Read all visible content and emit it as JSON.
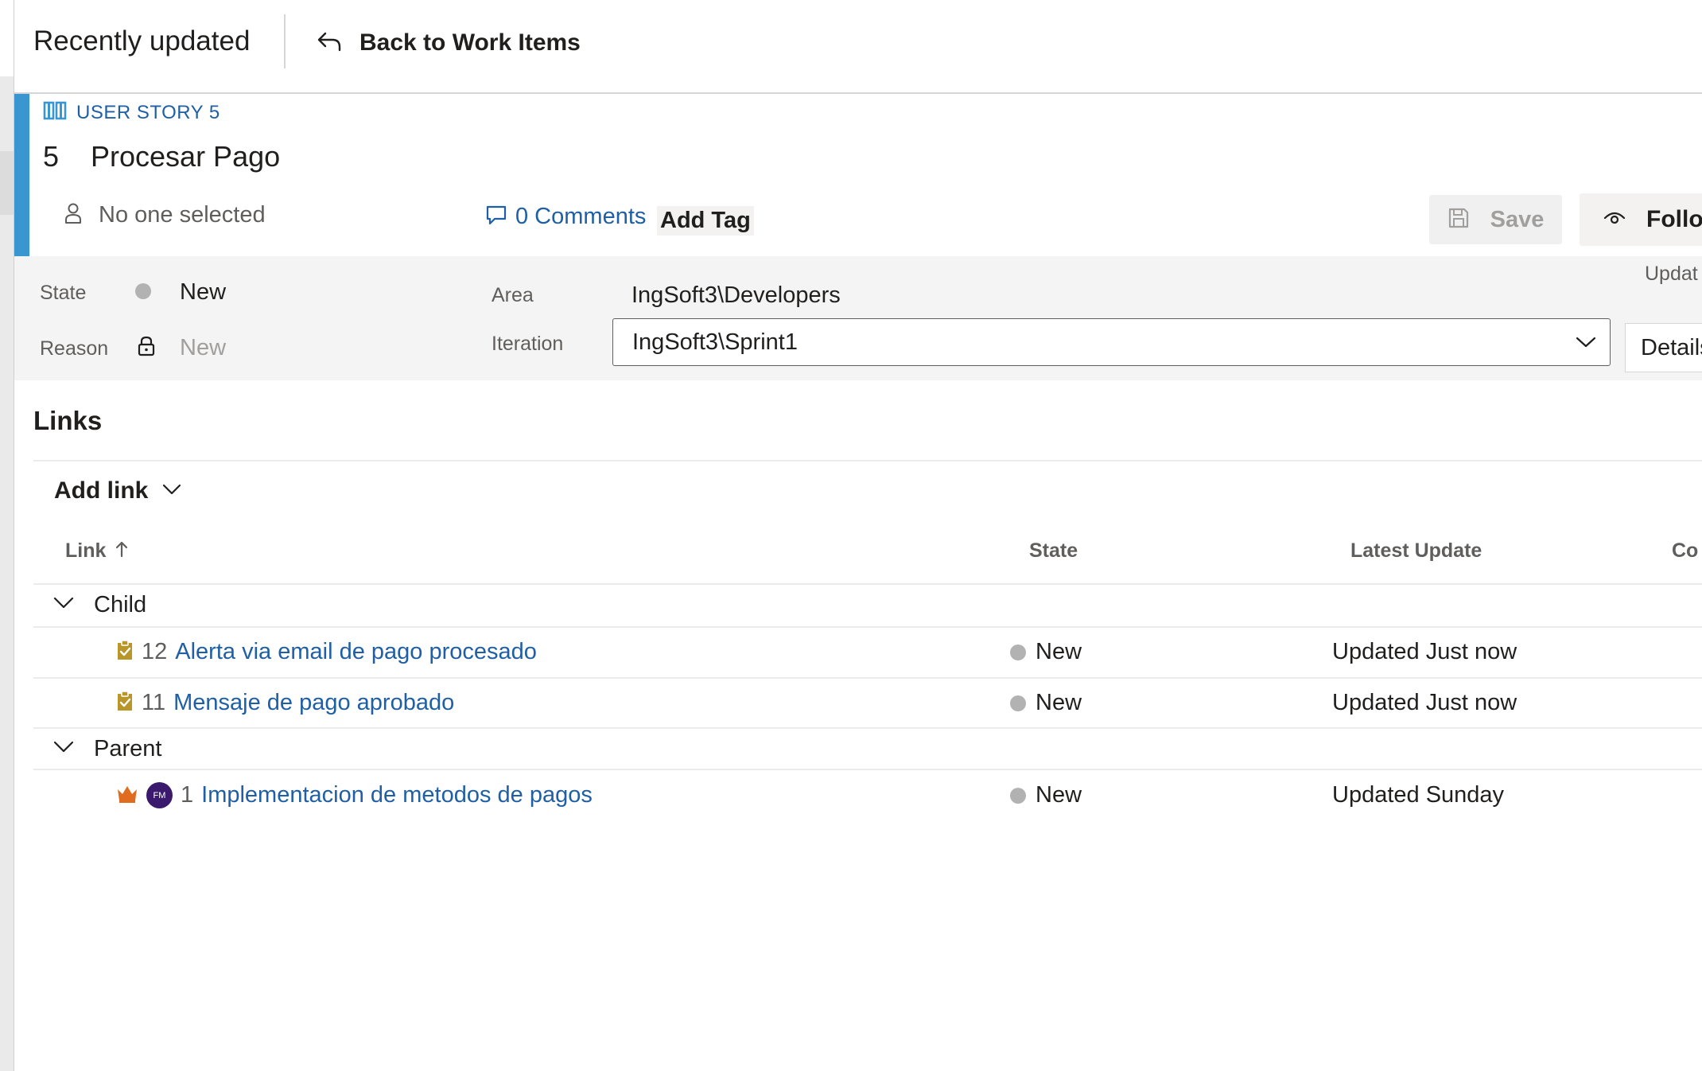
{
  "header": {
    "title": "Recently updated",
    "back_label": "Back to Work Items"
  },
  "work_item": {
    "type_label": "USER STORY 5",
    "id": "5",
    "title": "Procesar Pago",
    "assignee": "No one selected",
    "comments_label": "0 Comments",
    "add_tag_label": "Add Tag",
    "save_label": "Save",
    "follow_label": "Follow",
    "accent_color": "#3a96d1"
  },
  "fields": {
    "state_label": "State",
    "state_value": "New",
    "reason_label": "Reason",
    "reason_value": "New",
    "area_label": "Area",
    "area_value": "IngSoft3\\Developers",
    "iteration_label": "Iteration",
    "iteration_value": "IngSoft3\\Sprint1",
    "updated_label": "Updat",
    "details_tab": "Details"
  },
  "links": {
    "title": "Links",
    "add_link_label": "Add link",
    "columns": {
      "link": "Link",
      "state": "State",
      "latest_update": "Latest Update",
      "comment": "Co"
    },
    "groups": [
      {
        "name": "Child",
        "items": [
          {
            "id": "12",
            "title": "Alerta via email de pago procesado",
            "state": "New",
            "updated": "Updated Just now",
            "icon": "task-icon"
          },
          {
            "id": "11",
            "title": "Mensaje de pago aprobado",
            "state": "New",
            "updated": "Updated Just now",
            "icon": "task-icon"
          }
        ]
      },
      {
        "name": "Parent",
        "items": [
          {
            "id": "1",
            "title": "Implementacion de metodos de pagos",
            "state": "New",
            "updated": "Updated Sunday",
            "icon": "epic-crown-icon",
            "avatar": "FM"
          }
        ]
      }
    ]
  },
  "colors": {
    "link": "#1f5fa5",
    "task_icon": "#b8962a",
    "epic_icon": "#e06c1f",
    "state_new": "#b2b2b2"
  }
}
